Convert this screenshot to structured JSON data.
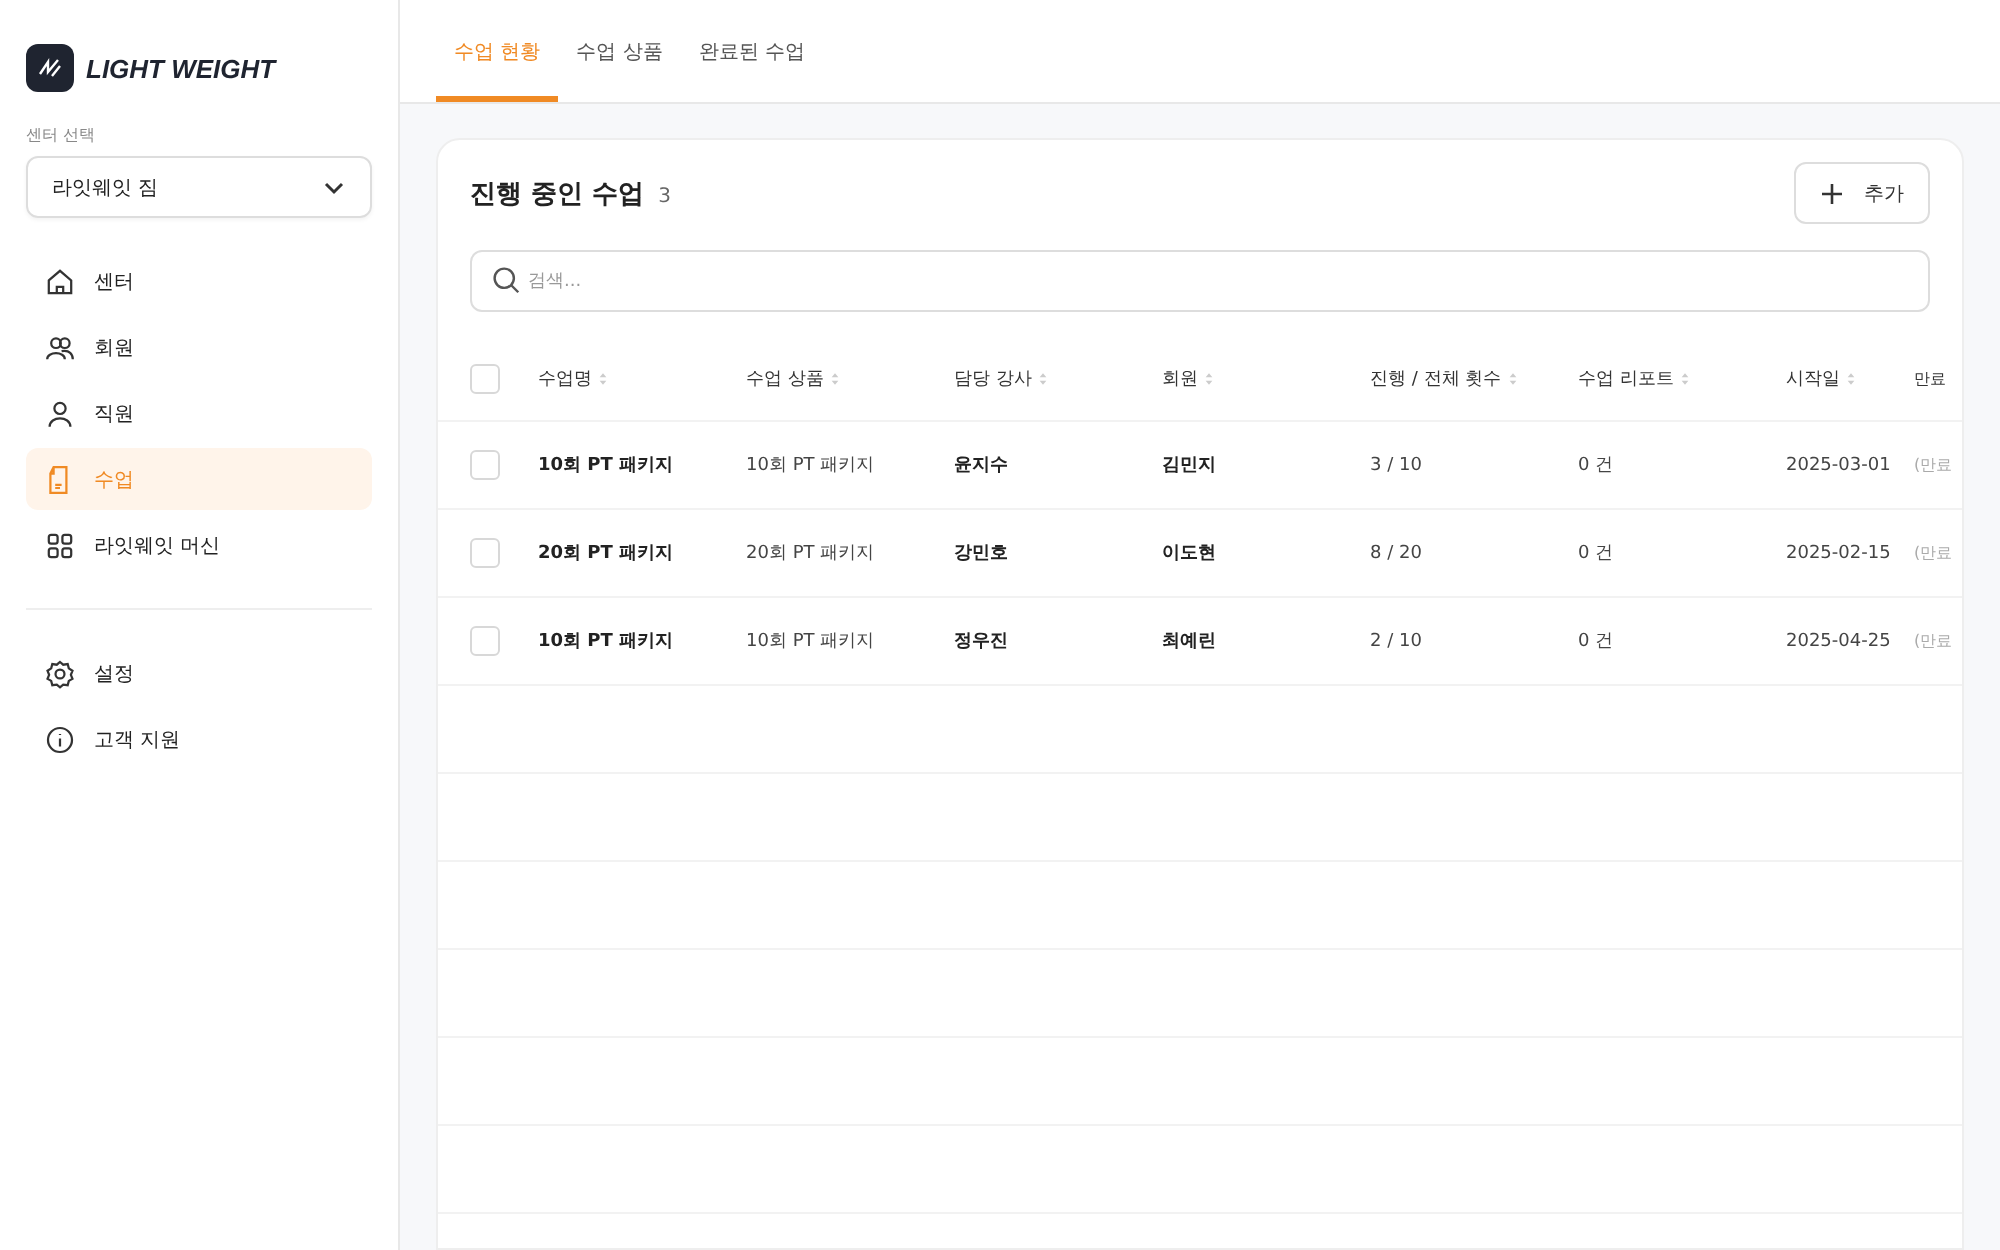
{
  "brand": {
    "name": "LIGHT WEIGHT"
  },
  "center_select": {
    "label": "센터 선택",
    "value": "라잇웨잇 짐"
  },
  "nav": [
    {
      "label": "센터",
      "selected": false
    },
    {
      "label": "회원",
      "selected": false
    },
    {
      "label": "직원",
      "selected": false
    },
    {
      "label": "수업",
      "selected": true
    },
    {
      "label": "라잇웨잇 머신",
      "selected": false
    }
  ],
  "nav_bottom": [
    {
      "label": "설정"
    },
    {
      "label": "고객 지원"
    }
  ],
  "tabs": [
    {
      "label": "수업 현황",
      "selected": true
    },
    {
      "label": "수업 상품",
      "selected": false
    },
    {
      "label": "완료된 수업",
      "selected": false
    }
  ],
  "card": {
    "title": "진행 중인 수업",
    "count": "3",
    "add_button": "추가",
    "search": {
      "placeholder": "검색..."
    }
  },
  "table": {
    "all_checked": false,
    "columns": [
      "수업명",
      "수업 상품",
      "담당 강사",
      "회원",
      "진행 / 전체 횟수",
      "수업 리포트",
      "시작일",
      "만료"
    ],
    "rows": [
      {
        "checked": false,
        "cells": [
          "10회 PT 패키지",
          "10회 PT 패키지",
          "윤지수",
          "김민지",
          "3 / 10",
          "0 건",
          "2025-03-01",
          "(만료"
        ]
      },
      {
        "checked": false,
        "cells": [
          "20회 PT 패키지",
          "20회 PT 패키지",
          "강민호",
          "이도현",
          "8 / 20",
          "0 건",
          "2025-02-15",
          "(만료"
        ]
      },
      {
        "checked": false,
        "cells": [
          "10회 PT 패키지",
          "10회 PT 패키지",
          "정우진",
          "최예린",
          "2 / 10",
          "0 건",
          "2025-04-25",
          "(만료"
        ]
      }
    ]
  }
}
